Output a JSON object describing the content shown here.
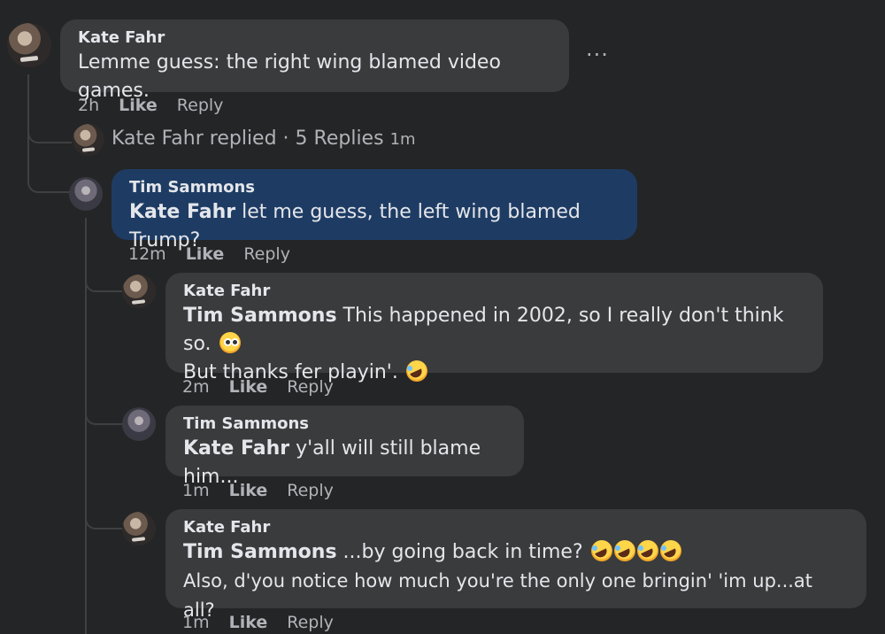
{
  "comment1": {
    "author": "Kate Fahr",
    "text": "Lemme guess: the right wing blamed video games.",
    "time": "2h",
    "like": "Like",
    "reply": "Reply",
    "more": "···"
  },
  "replies_summary": {
    "text": "Kate Fahr replied · 5 Replies",
    "time": "1m"
  },
  "comment2": {
    "author": "Tim Sammons",
    "mention": "Kate Fahr",
    "text": " let me guess, the left wing blamed Trump?",
    "time": "12m",
    "like": "Like",
    "reply": "Reply"
  },
  "comment3": {
    "author": "Kate Fahr",
    "mention": "Tim Sammons",
    "text1": " This happened in 2002, so I really don't think so. ",
    "text2": "But thanks fer playin'. ",
    "time": "2m",
    "like": "Like",
    "reply": "Reply"
  },
  "comment4": {
    "author": "Tim Sammons",
    "mention": "Kate Fahr",
    "text": " y'all will still blame him...",
    "time": "1m",
    "like": "Like",
    "reply": "Reply"
  },
  "comment5": {
    "author": "Kate Fahr",
    "mention": "Tim Sammons",
    "text1": " ...by going back in time? ",
    "text2": "Also, d'you notice how much you're the only one bringin' 'im up...at all?",
    "time": "1m",
    "like": "Like",
    "reply": "Reply"
  }
}
